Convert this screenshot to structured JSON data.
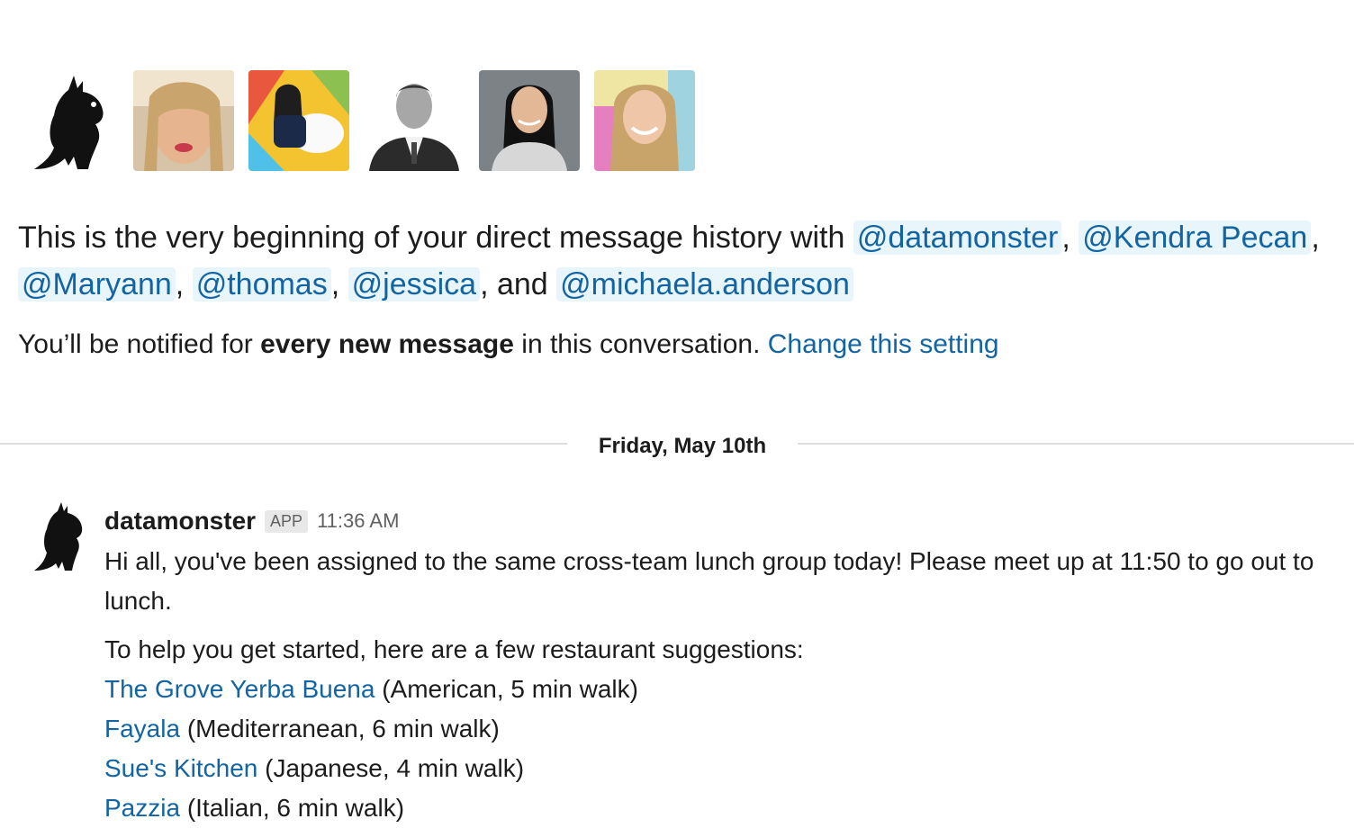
{
  "avatars": [
    {
      "name": "datamonster",
      "icon": "monster-icon"
    },
    {
      "name": "Kendra Pecan",
      "icon": "avatar-photo"
    },
    {
      "name": "Maryann",
      "icon": "avatar-photo"
    },
    {
      "name": "thomas",
      "icon": "avatar-photo"
    },
    {
      "name": "jessica",
      "icon": "avatar-photo"
    },
    {
      "name": "michaela.anderson",
      "icon": "avatar-photo"
    }
  ],
  "intro": {
    "prefix": "This is the very beginning of your direct message history with ",
    "mentions": [
      "@datamonster",
      "@Kendra Pecan",
      "@Maryann",
      "@thomas",
      "@jessica",
      "@michaela.anderson"
    ],
    "sep": ", ",
    "and": ", and "
  },
  "notify": {
    "pre": "You’ll be notified for ",
    "bold": "every new message",
    "post": " in this conversation. ",
    "link": "Change this setting"
  },
  "divider": {
    "date": "Friday, May 10th"
  },
  "message": {
    "sender": "datamonster",
    "badge": "APP",
    "time": "11:36 AM",
    "p1": "Hi all, you've been assigned to the same cross-team lunch group today! Please meet up at 11:50 to go out to lunch.",
    "p2": "To help you get started, here are a few restaurant suggestions:",
    "restaurants": [
      {
        "name": "The Grove Yerba Buena",
        "detail": " (American, 5 min walk)"
      },
      {
        "name": "Fayala",
        "detail": " (Mediterranean, 6 min walk)"
      },
      {
        "name": "Sue's Kitchen",
        "detail": " (Japanese, 4 min walk)"
      },
      {
        "name": "Pazzia",
        "detail": " (Italian, 6 min walk)"
      }
    ]
  },
  "colors": {
    "link": "#1264a3",
    "mention_bg": "#e8f5fa"
  }
}
